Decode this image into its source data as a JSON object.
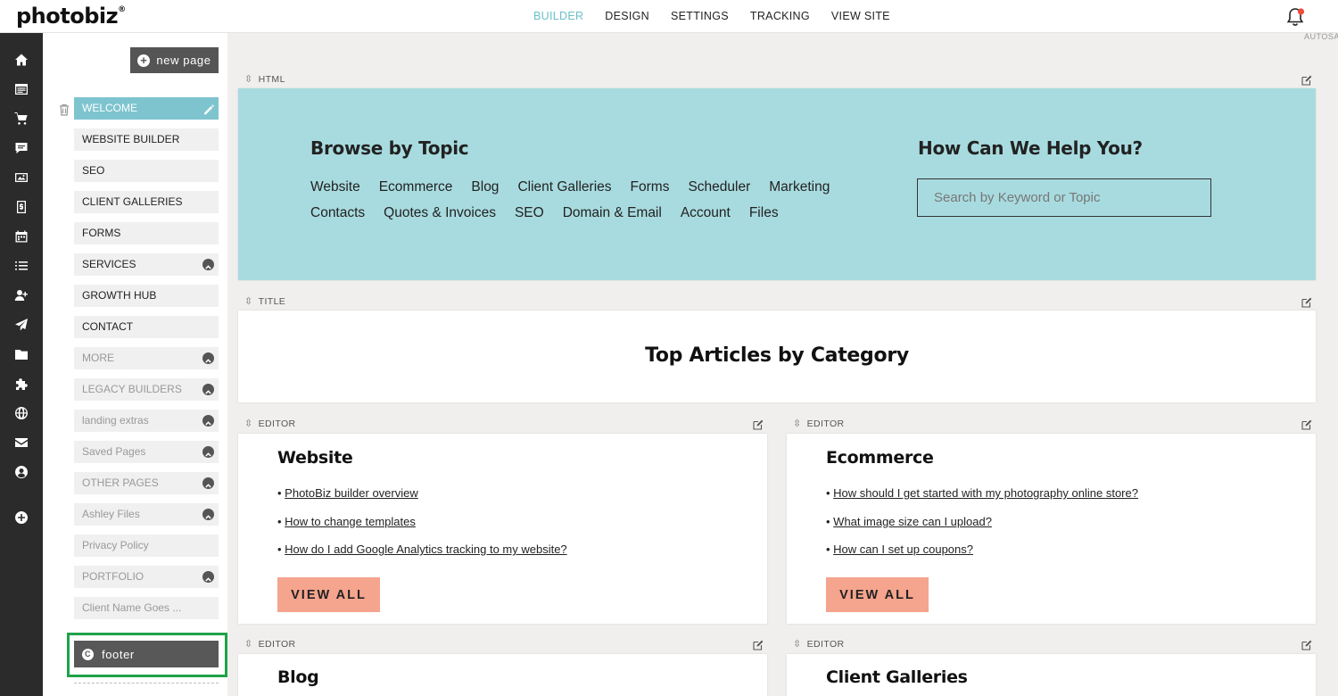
{
  "app": {
    "logo": "photobiz",
    "logo_mark": "®"
  },
  "topnav": {
    "items": [
      "BUILDER",
      "DESIGN",
      "SETTINGS",
      "TRACKING",
      "VIEW SITE"
    ],
    "active": "BUILDER"
  },
  "status": {
    "autosave": "AUTOSA"
  },
  "rail": {
    "icons": [
      "home-icon",
      "website-icon",
      "cart-icon",
      "chat-icon",
      "gallery-icon",
      "invoice-icon",
      "calendar-icon",
      "list-icon",
      "contacts-icon",
      "send-icon",
      "folder-icon",
      "puzzle-icon",
      "globe-icon",
      "mail-icon",
      "account-icon",
      "add-circle-icon"
    ]
  },
  "pages_panel": {
    "new_page_label": "new page",
    "items": [
      {
        "label": "WELCOME",
        "state": "active"
      },
      {
        "label": "WEBSITE BUILDER",
        "state": "normal"
      },
      {
        "label": "SEO",
        "state": "normal"
      },
      {
        "label": "CLIENT GALLERIES",
        "state": "normal"
      },
      {
        "label": "FORMS",
        "state": "normal"
      },
      {
        "label": "SERVICES",
        "state": "normal",
        "expandable": true
      },
      {
        "label": "GROWTH HUB",
        "state": "normal"
      },
      {
        "label": "CONTACT",
        "state": "normal"
      },
      {
        "label": "MORE",
        "state": "muted",
        "expandable": true
      },
      {
        "label": "LEGACY BUILDERS",
        "state": "muted",
        "expandable": true
      },
      {
        "label": "landing extras",
        "state": "muted",
        "expandable": true
      },
      {
        "label": "Saved Pages",
        "state": "muted",
        "expandable": true
      },
      {
        "label": "OTHER PAGES",
        "state": "muted",
        "expandable": true
      },
      {
        "label": "Ashley Files",
        "state": "muted",
        "expandable": true
      },
      {
        "label": "Privacy Policy",
        "state": "muted"
      },
      {
        "label": "PORTFOLIO",
        "state": "muted",
        "expandable": true
      },
      {
        "label": "Client Name Goes ...",
        "state": "muted"
      }
    ],
    "footer_label": "footer",
    "footer_highlight_color": "#1fa34a"
  },
  "blocks": {
    "html": {
      "type_label": "HTML",
      "browse_title": "Browse by Topic",
      "topics": [
        "Website",
        "Ecommerce",
        "Blog",
        "Client Galleries",
        "Forms",
        "Scheduler",
        "Marketing",
        "Contacts",
        "Quotes & Invoices",
        "SEO",
        "Domain & Email",
        "Account",
        "Files"
      ],
      "help_title": "How Can We Help You?",
      "search_placeholder": "Search by Keyword or Topic",
      "background": "#a8dbdf"
    },
    "title": {
      "type_label": "TITLE",
      "text": "Top Articles by Category"
    },
    "cards": [
      {
        "type_label": "EDITOR",
        "title": "Website",
        "links": [
          "PhotoBiz builder overview",
          "How to change templates",
          "How do I add Google Analytics tracking to my website?"
        ],
        "button": "VIEW ALL"
      },
      {
        "type_label": "EDITOR",
        "title": "Ecommerce",
        "links": [
          "How should I get started with my photography online store?",
          "What image size can I upload?",
          "How can I set up coupons?"
        ],
        "button": "VIEW ALL"
      },
      {
        "type_label": "EDITOR",
        "title": "Blog"
      },
      {
        "type_label": "EDITOR",
        "title": "Client Galleries"
      }
    ],
    "button_color": "#f5a48d"
  }
}
